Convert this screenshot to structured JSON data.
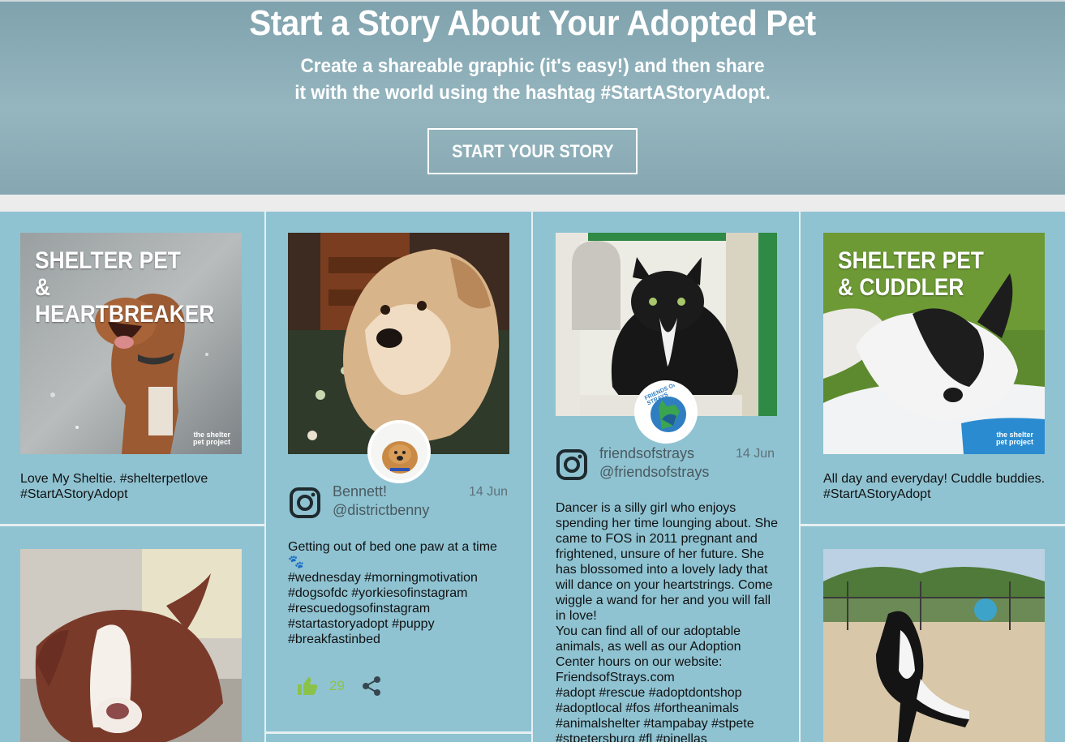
{
  "hero": {
    "title": "Start a Story About Your Adopted Pet",
    "subtitle_line1": "Create a shareable graphic (it's easy!) and then share",
    "subtitle_line2": "it with the world using the hashtag #StartAStoryAdopt.",
    "cta_label": "START YOUR STORY"
  },
  "cards": {
    "c1": {
      "overlay_line1": "SHELTER PET",
      "overlay_line2": "& HEARTBREAKER",
      "brand": "the shelter pet project",
      "caption_line1": "Love My Sheltie. #shelterpetlove",
      "caption_line2": "#StartAStoryAdopt"
    },
    "c2": {
      "name": "Bennett!",
      "handle": "@districtbenny",
      "date": "14 Jun",
      "text": "Getting out of bed one paw at a time\n🐾\n#wednesday #morningmotivation\n#dogsofdc #yorkiesofinstagram\n#rescuedogsofinstagram\n#startastoryadopt #puppy\n#breakfastinbed",
      "likes": "29"
    },
    "c3": {
      "name": "friendsofstrays",
      "handle": "@friendsofstrays",
      "date": "14 Jun",
      "avatar_text": "FRIENDS OF STRAYS",
      "text": "Dancer is a silly girl who enjoys\nspending her time lounging about. She\ncame to FOS in 2011 pregnant and\nfrightened, unsure of her future. She\nhas blossomed into a lovely lady that\nwill dance on your heartstrings. Come\nwiggle a wand for her and you will fall\nin love!\nYou can find all of our adoptable\nanimals, as well as our Adoption\nCenter hours on our website:\nFriendsofStrays.com\n#adopt #rescue #adoptdontshop\n#adoptlocal #fos #fortheanimals\n#animalshelter #tampabay #stpete\n#stpetersburg #fl #pinellas"
    },
    "c4": {
      "overlay_line1": "SHELTER PET",
      "overlay_line2": "& CUDDLER",
      "brand": "the shelter pet project",
      "caption_line1": "All day and everyday! Cuddle buddies.",
      "caption_line2": "#StartAStoryAdopt"
    }
  },
  "colors": {
    "tile_bg": "#8fc3d2",
    "hero_bg": "#8fb0ba",
    "like_green": "#8bc34a"
  },
  "icons": [
    "instagram-icon",
    "thumbs-up-icon",
    "share-icon",
    "paw-icon"
  ]
}
